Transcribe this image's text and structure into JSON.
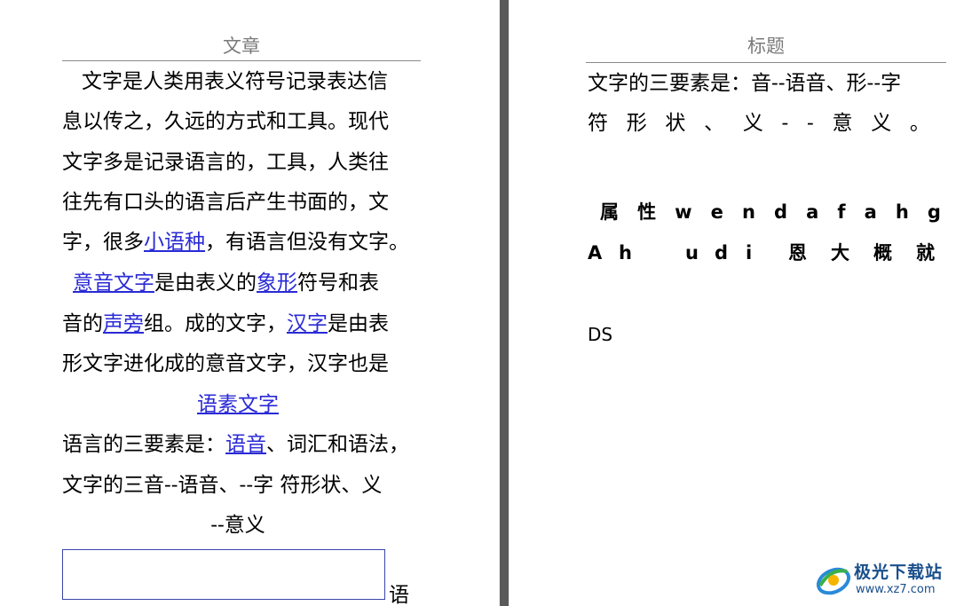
{
  "left_page": {
    "header": "文章",
    "lines": [
      [
        "文字是人类用表义符号记录表达信"
      ],
      [
        "息以传之，久远的方式和工具。现代"
      ],
      [
        "文字多是记录语言的，工具，人类往"
      ],
      [
        "往先有口头的语言后产生书面的，文"
      ],
      [
        "字，很多",
        "小语种",
        "，有语言但没有文字。"
      ],
      [
        "意音文字",
        "是由表义的",
        "象形",
        "符号和表"
      ],
      [
        "音的",
        "声旁",
        "组。成的文字，",
        "汉字",
        "是由表"
      ],
      [
        "形文字进化成的意音文字，汉字也是"
      ],
      [
        "语素文字"
      ],
      [
        "语言的三要素是：",
        "语音",
        "、词汇和语法，"
      ],
      [
        "文字的三音--语音、--字  符形状、义"
      ],
      [
        "--意义"
      ]
    ],
    "textbox_trailing": "语"
  },
  "right_page": {
    "header": "标题",
    "line1": "文字的三要素是：音--语音、形--字",
    "line2": [
      "符",
      "形",
      "状",
      "、",
      "义",
      "-",
      "-",
      "意",
      "义",
      "。"
    ],
    "bold_line1": [
      "属",
      "性",
      "w",
      "e",
      "n",
      "d",
      "a",
      "f",
      "a",
      "h",
      "g"
    ],
    "bold_line2": [
      "A",
      "h",
      "u",
      "d",
      "i",
      "恩",
      "大",
      "概",
      "就"
    ],
    "ds": "DS"
  },
  "watermark": {
    "title": "极光下载站",
    "url": "www.xz7.com"
  },
  "colors": {
    "link": "#2a2ad6",
    "header": "#7a7a7a",
    "divider": "#5a5a5a"
  }
}
